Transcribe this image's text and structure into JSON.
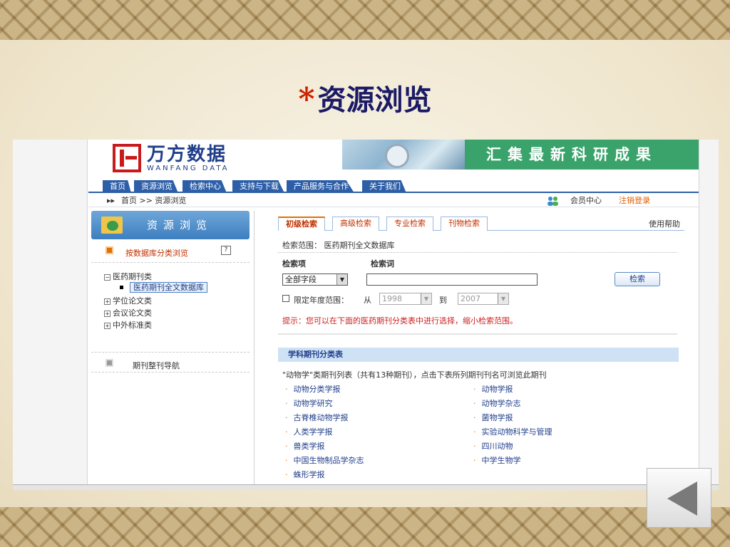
{
  "slide": {
    "star": "*",
    "title": "资源浏览"
  },
  "site": {
    "logo_cn": "万方数据",
    "logo_en": "WANFANG DATA",
    "slogan": "汇集最新科研成果"
  },
  "nav": {
    "tabs": [
      "首页",
      "资源浏览",
      "检索中心",
      "支持与下载",
      "产品服务与合作",
      "关于我们"
    ]
  },
  "breadcrumb": {
    "arrow": "▸▸",
    "path": "首页 >> 资源浏览",
    "member": "会员中心",
    "logout": "注销登录"
  },
  "sidebar": {
    "header": "资源浏览",
    "browse_by_db": "按数据库分类浏览",
    "help_mark": "?",
    "tree": [
      {
        "sign": "−",
        "label": "医药期刊类"
      },
      {
        "sign": "+",
        "label": "学位论文类"
      },
      {
        "sign": "+",
        "label": "会议论文类"
      },
      {
        "sign": "+",
        "label": "中外标准类"
      }
    ],
    "selected_db": "医药期刊全文数据库",
    "journal_nav": "期刊整刊导航"
  },
  "search": {
    "tabs": [
      "初级检索",
      "高级检索",
      "专业检索",
      "刊物检索"
    ],
    "help": "使用帮助",
    "scope_label": "检索范围：",
    "scope_value": "医药期刊全文数据库",
    "field_label": "检索项",
    "term_label": "检索词",
    "field_value": "全部字段",
    "term_value": "",
    "search_button": "检索",
    "limit_label": "限定年度范围：",
    "from_label": "从",
    "from_year": "1998",
    "to_label": "到",
    "to_year": "2007",
    "hint": "提示：您可以在下面的医药期刊分类表中进行选择，缩小检索范围。"
  },
  "subjects": {
    "header": "学科期刊分类表",
    "note": "\"动物学\"类期刊列表（共有13种期刊），点击下表所列期刊刊名可浏览此期刊",
    "left": [
      "动物分类学报",
      "动物学研究",
      "古脊椎动物学报",
      "人类学学报",
      "兽类学报",
      "中国生物制品学杂志",
      "蛛形学报"
    ],
    "right": [
      "动物学报",
      "动物学杂志",
      "菌物学报",
      "实验动物科学与管理",
      "四川动物",
      "中学生物学"
    ]
  },
  "colors": {
    "title": "#1a1a66",
    "star": "#cc2200",
    "nav": "#2d5fa8",
    "slogan_bg": "#3aa36b",
    "hint": "#cc1e1e"
  },
  "icons": {
    "back": "back-arrow-icon",
    "member": "members-icon",
    "folder": "folder-globe-icon"
  }
}
